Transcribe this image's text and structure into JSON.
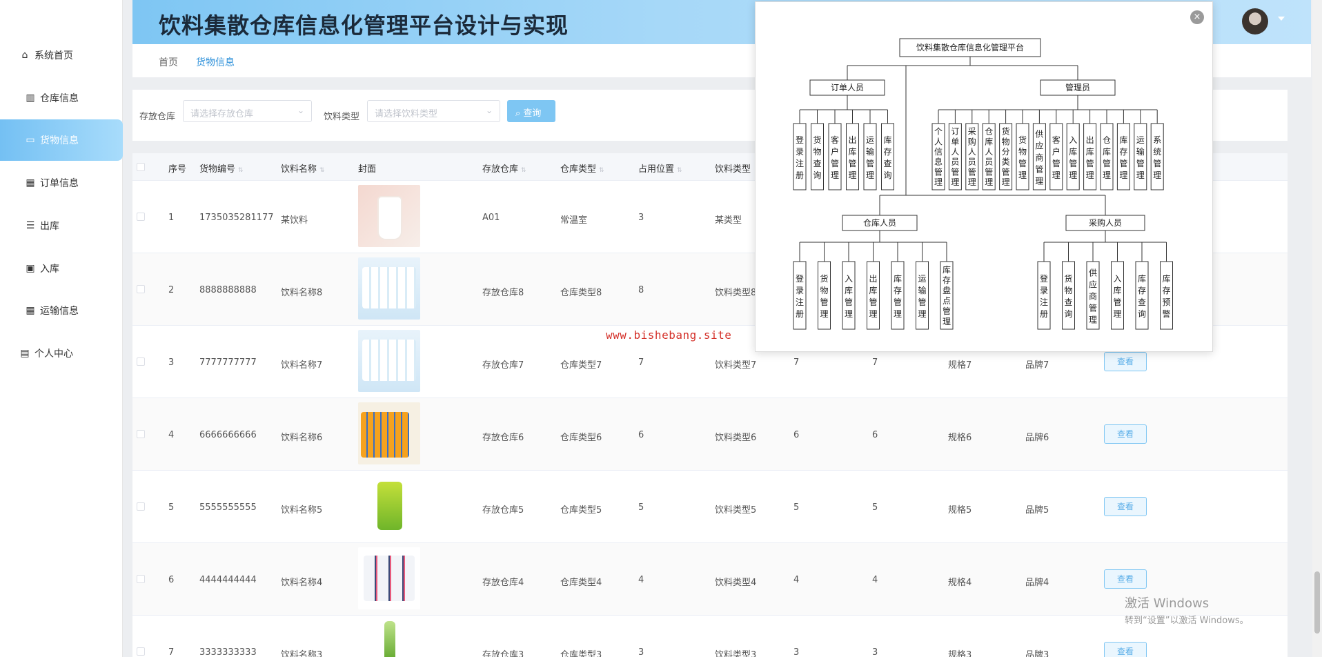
{
  "header": {
    "title": "饮料集散仓库信息化管理平台设计与实现"
  },
  "breadcrumb": {
    "home": "首页",
    "current": "货物信息"
  },
  "sidebar": {
    "items": [
      {
        "label": "系统首页",
        "icon": "home-icon"
      },
      {
        "label": "仓库信息",
        "icon": "library-icon"
      },
      {
        "label": "货物信息",
        "icon": "monitor-icon",
        "active": true
      },
      {
        "label": "订单信息",
        "icon": "grid-icon"
      },
      {
        "label": "出库",
        "icon": "sliders-icon"
      },
      {
        "label": "入库",
        "icon": "clipboard-check-icon"
      },
      {
        "label": "运输信息",
        "icon": "grid-icon"
      },
      {
        "label": "个人中心",
        "icon": "calendar-icon"
      }
    ]
  },
  "search": {
    "warehouse_label": "存放仓库",
    "warehouse_placeholder": "请选择存放仓库",
    "type_label": "饮料类型",
    "type_placeholder": "请选择饮料类型",
    "button": "查询"
  },
  "table": {
    "columns": [
      "序号",
      "货物编号",
      "饮料名称",
      "封面",
      "存放仓库",
      "仓库类型",
      "占用位置",
      "饮料类型"
    ],
    "view_label": "查看",
    "rows": [
      {
        "idx": "1",
        "code": "1735035281177",
        "name": "某饮料",
        "cover": "milk-tea-cup",
        "warehouse": "A01",
        "wtype": "常温室",
        "pos": "3",
        "btype": "某类型",
        "c9": "",
        "c10": "",
        "spec": "",
        "brand": ""
      },
      {
        "idx": "2",
        "code": "8888888888",
        "name": "饮料名称8",
        "cover": "water-bottles",
        "warehouse": "存放仓库8",
        "wtype": "仓库类型8",
        "pos": "8",
        "btype": "饮料类型8",
        "c9": "",
        "c10": "",
        "spec": "",
        "brand": ""
      },
      {
        "idx": "3",
        "code": "7777777777",
        "name": "饮料名称7",
        "cover": "water-bottles",
        "warehouse": "存放仓库7",
        "wtype": "仓库类型7",
        "pos": "7",
        "btype": "饮料类型7",
        "c9": "7",
        "c10": "7",
        "spec": "规格7",
        "brand": "品牌7"
      },
      {
        "idx": "4",
        "code": "6666666666",
        "name": "饮料名称6",
        "cover": "orange-soda-pack",
        "warehouse": "存放仓库6",
        "wtype": "仓库类型6",
        "pos": "6",
        "btype": "饮料类型6",
        "c9": "6",
        "c10": "6",
        "spec": "规格6",
        "brand": "品牌6"
      },
      {
        "idx": "5",
        "code": "5555555555",
        "name": "饮料名称5",
        "cover": "green-can",
        "warehouse": "存放仓库5",
        "wtype": "仓库类型5",
        "pos": "5",
        "btype": "饮料类型5",
        "c9": "5",
        "c10": "5",
        "spec": "规格5",
        "brand": "品牌5"
      },
      {
        "idx": "6",
        "code": "4444444444",
        "name": "饮料名称4",
        "cover": "drink-packs",
        "warehouse": "存放仓库4",
        "wtype": "仓库类型4",
        "pos": "4",
        "btype": "饮料类型4",
        "c9": "4",
        "c10": "4",
        "spec": "规格4",
        "brand": "品牌4"
      },
      {
        "idx": "7",
        "code": "3333333333",
        "name": "饮料名称3",
        "cover": "green-bottle",
        "warehouse": "存放仓库3",
        "wtype": "仓库类型3",
        "pos": "3",
        "btype": "饮料类型3",
        "c9": "3",
        "c10": "3",
        "spec": "规格3",
        "brand": "品牌3"
      }
    ]
  },
  "modal": {
    "diagram": {
      "root": "饮料集散仓库信息化管理平台",
      "order_role": "订单人员",
      "admin_role": "管理员",
      "warehouse_role": "仓库人员",
      "purchase_role": "采购人员",
      "order_children": [
        "登录注册",
        "货物查询",
        "客户管理",
        "出库管理",
        "运输管理",
        "库存查询"
      ],
      "admin_children": [
        "个人信息管理",
        "订单人员管理",
        "采购人员管理",
        "仓库人员管理",
        "货物分类管理",
        "货物管理",
        "供应商管理",
        "客户管理",
        "入库管理",
        "出库管理",
        "仓库管理",
        "库存管理",
        "运输管理",
        "系统管理"
      ],
      "warehouse_children": [
        "登录注册",
        "货物管理",
        "入库管理",
        "出库管理",
        "库存管理",
        "运输管理",
        "库存盘点管理"
      ],
      "purchase_children": [
        "登录注册",
        "货物查询",
        "供应商管理",
        "入库管理",
        "库存查询",
        "库存预警"
      ]
    }
  },
  "watermark": "www.bishebang.site",
  "windows_activation": {
    "line1": "激活 Windows",
    "line2": "转到“设置”以激活 Windows。"
  }
}
